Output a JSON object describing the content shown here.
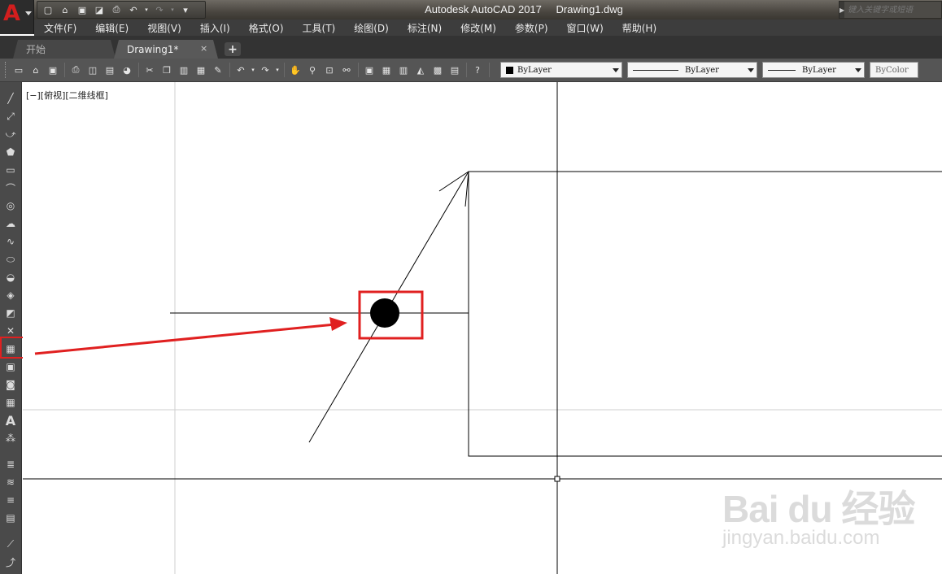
{
  "window": {
    "app_name": "Autodesk AutoCAD 2017",
    "file_name": "Drawing1.dwg",
    "search_placeholder": "键入关键字或短语"
  },
  "menu": [
    "文件(F)",
    "编辑(E)",
    "视图(V)",
    "插入(I)",
    "格式(O)",
    "工具(T)",
    "绘图(D)",
    "标注(N)",
    "修改(M)",
    "参数(P)",
    "窗口(W)",
    "帮助(H)"
  ],
  "tabs": {
    "start": "开始",
    "drawing": "Drawing1*",
    "close_symbol": "×",
    "add_symbol": "+"
  },
  "toolbar": {
    "layer_dropdown": "ByLayer",
    "linetype_dropdown": "ByLayer",
    "lineweight_dropdown": "ByLayer",
    "color_dropdown": "ByColor"
  },
  "canvas": {
    "viewport_label": "[−][俯视][二维线框]"
  },
  "watermark": {
    "brand": "Bai du 经验",
    "url": "jingyan.baidu.com"
  },
  "colors": {
    "logo_red": "#d21e1e",
    "highlight_red": "#e02020",
    "canvas_bg": "#ffffff",
    "menubar_bg": "#3d3d3d"
  }
}
